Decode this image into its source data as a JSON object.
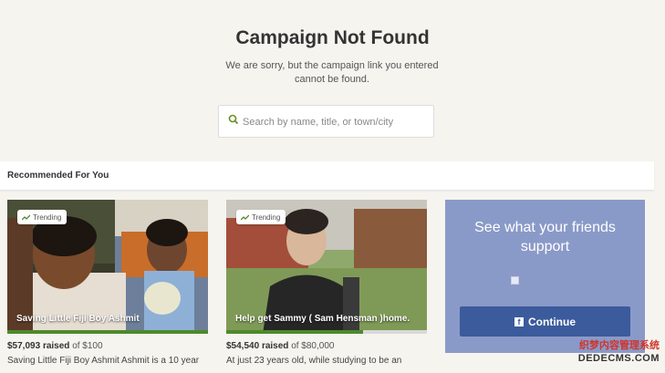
{
  "header": {
    "title": "Campaign Not Found",
    "subtitle": "We are sorry, but the campaign link you entered cannot be found."
  },
  "search": {
    "placeholder": "Search by name, title, or town/city",
    "icon": "search-icon"
  },
  "recommended": {
    "heading": "Recommended For You"
  },
  "campaigns": [
    {
      "badge": "Trending",
      "title": "Saving Little Fiji Boy Ashmit",
      "raised_amount": "$57,093",
      "raised_suffix": "raised",
      "goal_text": "of $100",
      "progress_fraction": 1.0,
      "description": "Saving Little Fiji Boy Ashmit Ashmit is a 10 year"
    },
    {
      "badge": "Trending",
      "title": "Help get Sammy ( Sam Hensman )home.",
      "raised_amount": "$54,540",
      "raised_suffix": "raised",
      "goal_text": "of $80,000",
      "progress_fraction": 0.68,
      "description": "At just 23 years old,  while studying to be an"
    }
  ],
  "friends_panel": {
    "heading": "See what your friends support",
    "button_label": "Continue",
    "background": "#8a9ac8",
    "button_color": "#3b5b9c"
  },
  "watermark": {
    "line1": "织梦内容管理系统",
    "line2": "DEDECMS.COM"
  },
  "colors": {
    "page_bg": "#f6f4ef",
    "progress_fill": "#4d8a2b",
    "search_icon": "#6b8e23"
  }
}
